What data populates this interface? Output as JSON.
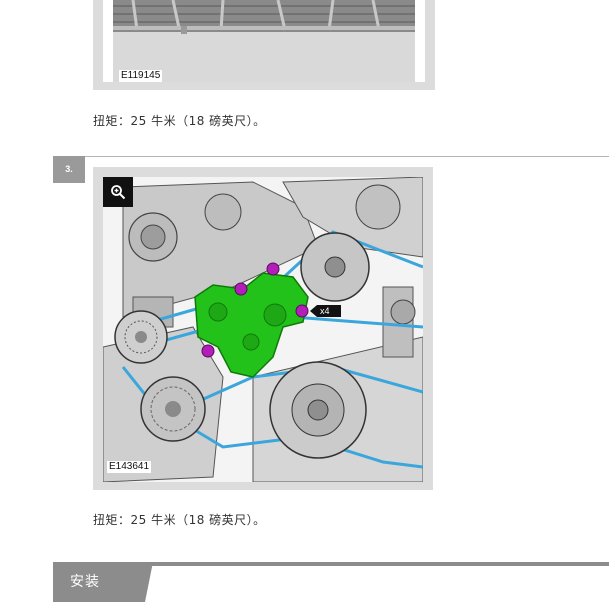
{
  "figures": [
    {
      "code": "E119145"
    },
    {
      "code": "E143641",
      "callout": "x4"
    }
  ],
  "torque_notes": [
    "扭矩：25 牛米（18 磅英尺）。",
    "扭矩：25 牛米（18 磅英尺）。"
  ],
  "step": {
    "number": "3."
  },
  "section": {
    "title": "安装"
  },
  "colors": {
    "frame": "#dcdcdc",
    "step_badge": "#9a9a9a",
    "section_bar": "#8c8c8c",
    "bracket": "#22c21a",
    "bolts": "#b21fb8",
    "belt": "#3aa6dc"
  },
  "icons": {
    "zoom": "magnify-plus-icon"
  }
}
